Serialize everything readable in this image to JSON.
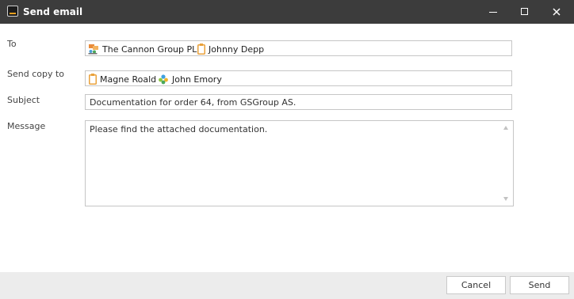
{
  "window": {
    "title": "Send email"
  },
  "form": {
    "to_label": "To",
    "to_recipients": [
      {
        "name": "The Cannon Group PLC",
        "icon": "company-contact-icon"
      },
      {
        "name": "Johnny Depp",
        "icon": "person-card-icon"
      }
    ],
    "cc_label": "Send copy to",
    "cc_recipients": [
      {
        "name": "Magne Roald",
        "icon": "person-card-icon"
      },
      {
        "name": "John Emory",
        "icon": "people-group-icon"
      }
    ],
    "subject_label": "Subject",
    "subject_value": "Documentation for order 64, from GSGroup AS.",
    "message_label": "Message",
    "message_value": "Please find the attached documentation."
  },
  "footer": {
    "cancel_label": "Cancel",
    "send_label": "Send"
  },
  "colors": {
    "titlebar": "#3c3c3c",
    "footer": "#ececec",
    "border": "#c6c6c6",
    "accent": "#e8a020"
  }
}
